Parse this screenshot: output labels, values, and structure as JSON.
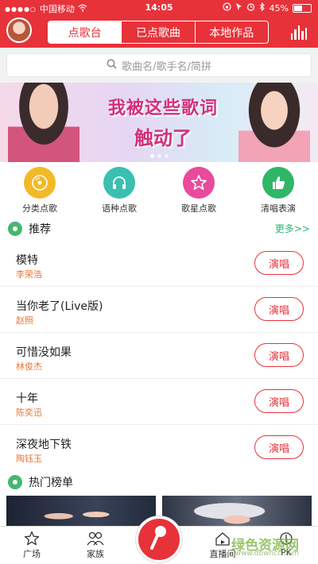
{
  "status_bar": {
    "carrier": "中国移动",
    "time": "14:05",
    "battery": "45%"
  },
  "header": {
    "tabs": [
      {
        "label": "点歌台",
        "active": true
      },
      {
        "label": "已点歌曲",
        "active": false
      },
      {
        "label": "本地作品",
        "active": false
      }
    ]
  },
  "search": {
    "placeholder": "歌曲名/歌手名/简拼"
  },
  "banner": {
    "line1": "我被这些歌词",
    "line2": "触动了"
  },
  "categories": [
    {
      "label": "分类点歌",
      "color": "#f2b928",
      "icon": "disc-icon"
    },
    {
      "label": "语种点歌",
      "color": "#3bbfb0",
      "icon": "headphones-icon"
    },
    {
      "label": "歌星点歌",
      "color": "#e94a9b",
      "icon": "star-icon"
    },
    {
      "label": "清唱表演",
      "color": "#2fb667",
      "icon": "thumbs-up-icon"
    }
  ],
  "recommend": {
    "title": "推荐",
    "more": "更多>>"
  },
  "songs": [
    {
      "title": "模特",
      "artist": "李荣浩",
      "button": "演唱"
    },
    {
      "title": "当你老了(Live版)",
      "artist": "赵照",
      "button": "演唱"
    },
    {
      "title": "可惜没如果",
      "artist": "林俊杰",
      "button": "演唱"
    },
    {
      "title": "十年",
      "artist": "陈奕迅",
      "button": "演唱"
    },
    {
      "title": "深夜地下铁",
      "artist": "陶钰玉",
      "button": "演唱"
    }
  ],
  "hot_chart": {
    "title": "热门榜单"
  },
  "bottom_nav": {
    "items": [
      "广场",
      "家族",
      "直播间",
      "PK"
    ]
  },
  "watermark": {
    "text": "绿色资源网",
    "url": "www.downcc.com"
  },
  "colors": {
    "brand_red": "#e8323a",
    "artist_orange": "#e8763a",
    "section_green": "#2bb673"
  }
}
